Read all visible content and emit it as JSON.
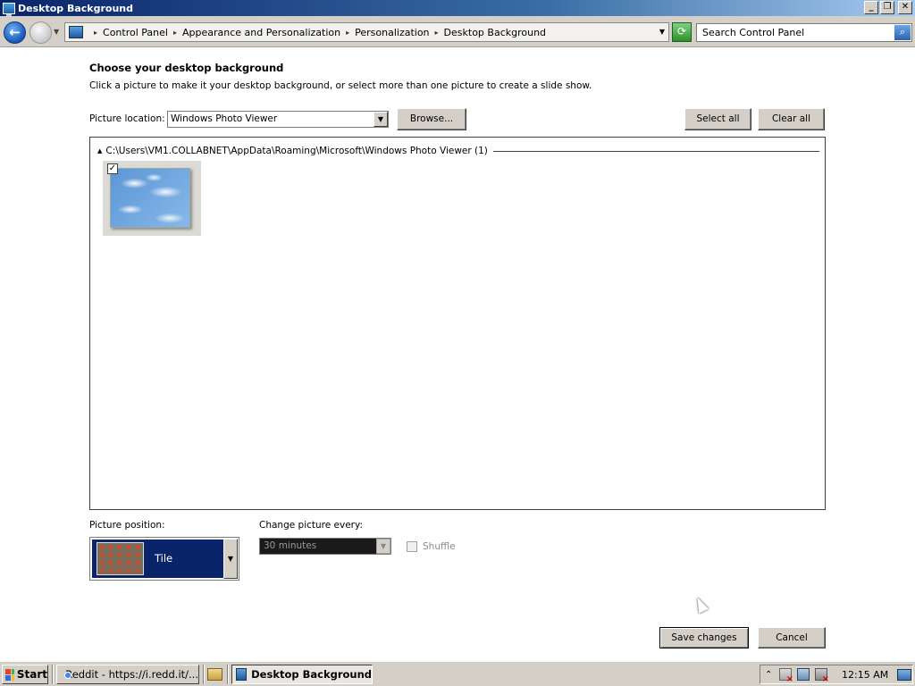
{
  "window": {
    "title": "Desktop Background",
    "controls": {
      "minimize": "_",
      "restore": "❐",
      "close": "✕"
    }
  },
  "address_bar": {
    "breadcrumb": [
      "Control Panel",
      "Appearance and Personalization",
      "Personalization",
      "Desktop Background"
    ],
    "search_placeholder": "Search Control Panel"
  },
  "main": {
    "heading": "Choose your desktop background",
    "description": "Click a picture to make it your desktop background, or select more than one picture to create a slide show.",
    "picture_location_label": "Picture location:",
    "picture_location_value": "Windows Photo Viewer",
    "browse_label": "Browse...",
    "select_all_label": "Select all",
    "clear_all_label": "Clear all",
    "gallery": {
      "group_path": "C:\\Users\\VM1.COLLABNET\\AppData\\Roaming\\Microsoft\\Windows Photo Viewer (1)",
      "items": [
        {
          "checked": true
        }
      ]
    },
    "picture_position_label": "Picture position:",
    "picture_position_value": "Tile",
    "change_every_label": "Change picture every:",
    "change_every_value": "30 minutes",
    "shuffle_label": "Shuffle",
    "save_label": "Save changes",
    "cancel_label": "Cancel"
  },
  "taskbar": {
    "start_label": "Start",
    "tasks": [
      {
        "label": "Reddit - https://i.redd.it/...",
        "active": false
      },
      {
        "label": "Desktop Background",
        "active": true
      }
    ],
    "clock": "12:15 AM"
  },
  "colors": {
    "title_gradient_start": "#0a246a",
    "selection": "#0a246a",
    "chrome_face": "#d4d0c8"
  }
}
